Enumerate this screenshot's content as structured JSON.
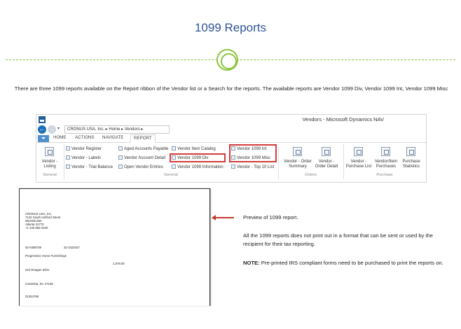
{
  "title": "1099 Reports",
  "intro_text": "There are three 1099 reports available on the Report ribbon of the Vendor list or a Search for the reports.  The available reports are Vendor 1099 Div, Vendor 1099 Int, Vendor 1099 Misc",
  "nav": {
    "window_title": "Vendors - Microsoft Dynamics NAV",
    "breadcrumb": "CRONUS USA, Inc. ▸ Home ▸ Vendors ▸",
    "tabs": [
      "HOME",
      "ACTIONS",
      "NAVIGATE",
      "REPORT"
    ],
    "active_tab": "REPORT",
    "listing_label_1": "Vendor -",
    "listing_label_2": "Listing",
    "general_group": "General",
    "col1": [
      "Vendor Register",
      "Vendor - Labels",
      "Vendor - Trial Balance"
    ],
    "col2": [
      "Aged Accounts Payable",
      "Vendor Account Detail",
      "Open Vendor Entries"
    ],
    "col3": [
      "Vendor Item Catalog",
      "Vendor 1099 Div",
      "Vendor 1099 Information"
    ],
    "col4": [
      "Vendor 1099 Int",
      "Vendor 1099 Misc",
      "Vendor - Top 10 List"
    ],
    "orders": [
      {
        "l1": "Vendor - Order",
        "l2": "Summary"
      },
      {
        "l1": "Vendor -",
        "l2": "Order Detail"
      }
    ],
    "orders_group": "Orders",
    "purchase": [
      {
        "l1": "Vendor -",
        "l2": "Purchase List"
      },
      {
        "l1": "Vendor/Item",
        "l2": "Purchases"
      },
      {
        "l1": "Purchase",
        "l2": "Statistics"
      }
    ],
    "purchase_group": "Purchase",
    "highlight_color": "#d23b3b"
  },
  "preview": {
    "company": "CRONUS USA, Inc.",
    "address1": "7122 South Ashford Street",
    "address2": "Westminster",
    "address3": "Atlanta  31772",
    "phone": "+1 425 555 0100",
    "id1": "52-0458739",
    "id2": "32-3423427",
    "vendor": "Progressive Home Furnishings",
    "amount": "1,578.00",
    "street": "222 Reagan Drive",
    "city": "Columbia, SC 27136",
    "account": "01254786"
  },
  "notes": {
    "preview_label": "Preview of 1099 report.",
    "paragraph": "All the 1099 reports does not print out in a format that can be sent or used by the recipient for their tax reporting.",
    "note_label": "NOTE:",
    "note_text": " Pre-printed IRS compliant forms need to be purchased to print the reports on."
  }
}
